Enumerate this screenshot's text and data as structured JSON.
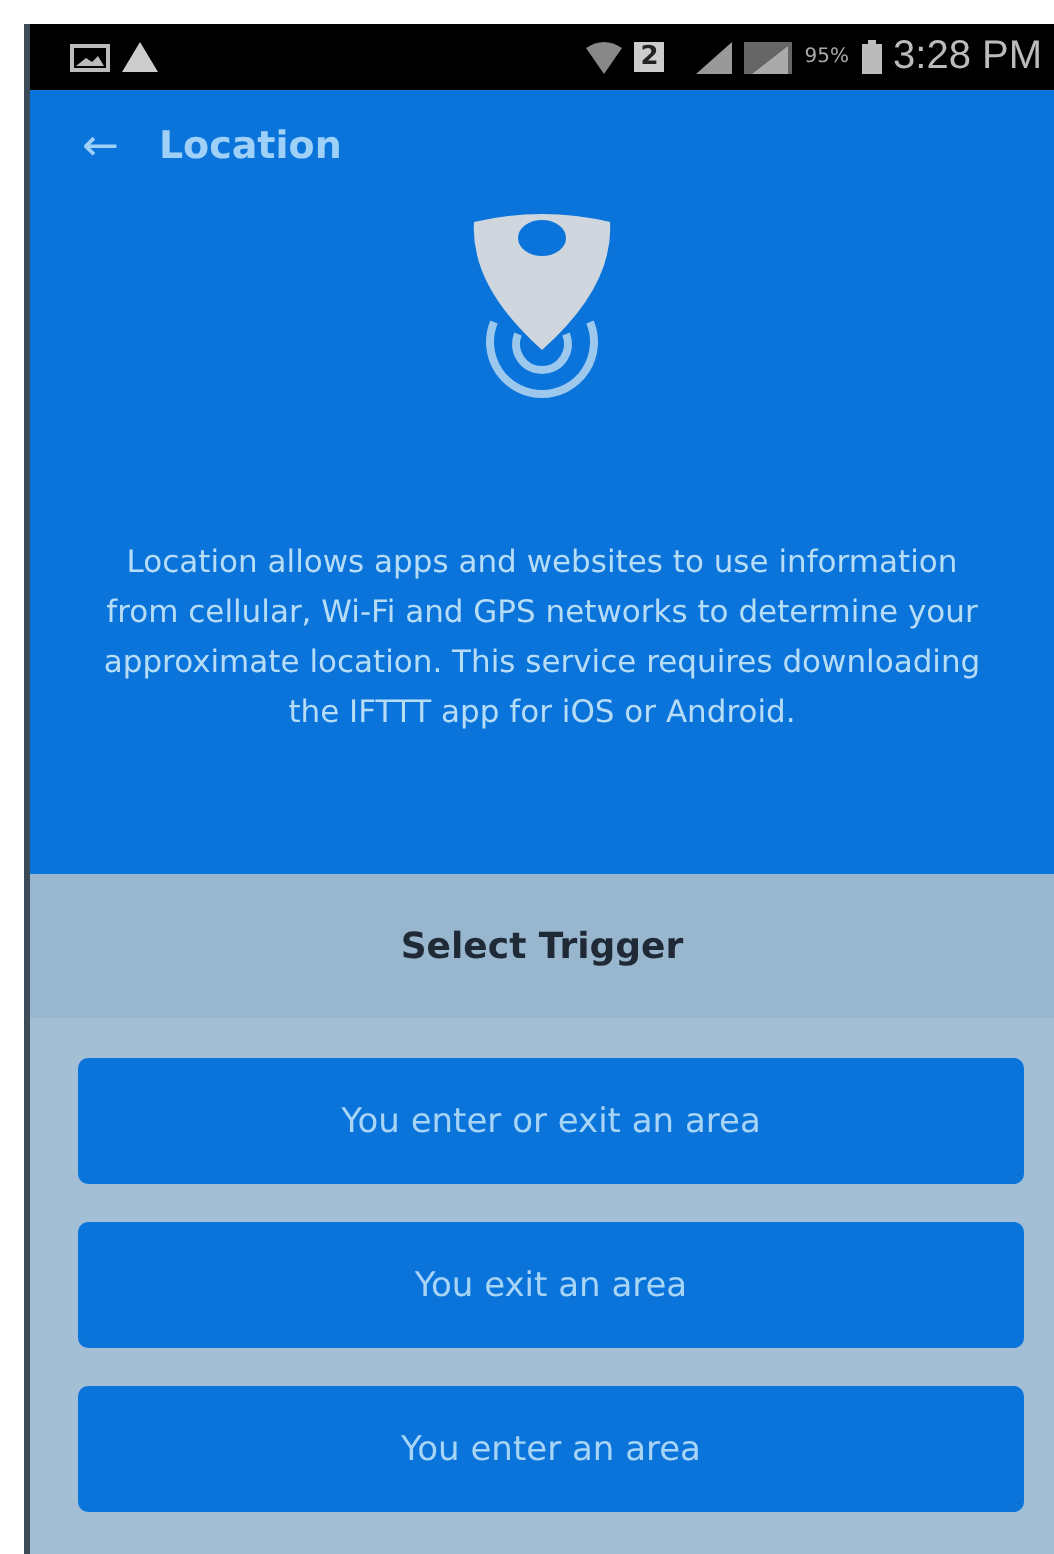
{
  "status_bar": {
    "sim": "2",
    "battery": "95%",
    "time": "3:28 PM"
  },
  "app_bar": {
    "back": "←",
    "title": "Location"
  },
  "description": "Location allows apps and websites to use information from cellular, Wi-Fi and GPS networks to determine your approximate location. This service requires downloading the IFTTT app for iOS or Android.",
  "section_title": "Select Trigger",
  "triggers": [
    {
      "label": "You enter or exit an area"
    },
    {
      "label": "You exit an area"
    },
    {
      "label": "You enter an area"
    }
  ]
}
